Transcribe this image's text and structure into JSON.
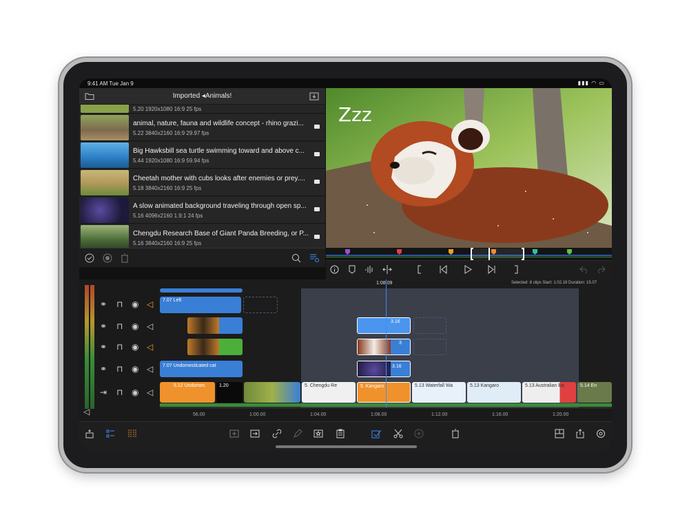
{
  "status_bar": {
    "time": "9:41 AM  Tue Jan 9",
    "indicators": "▮▮▮ ◠ ▭"
  },
  "browser": {
    "title": "Imported ◂Animals!",
    "clips": [
      {
        "title": "",
        "meta": "5.20  1920x1080  16:9  25 fps",
        "thumb": "#8aa04a"
      },
      {
        "title": "animal, nature, fauna and wildlife concept - rhino grazi...",
        "meta": "5.22  3840x2160  16:9  29.97 fps",
        "thumb": "#7d6a4f"
      },
      {
        "title": "Big Hawksbill sea turtle swimming toward and above c...",
        "meta": "5.44  1920x1080  16:9  59.94 fps",
        "thumb": "#2b7fc4"
      },
      {
        "title": "Cheetah mother with cubs looks after enemies or prey....",
        "meta": "5.18  3840x2160  16:9  25 fps",
        "thumb": "#b29a5a"
      },
      {
        "title": "A slow animated background traveling through open sp...",
        "meta": "5.16  4096x2160  1.9:1  24 fps",
        "thumb": "#1c1a3a"
      },
      {
        "title": "Chengdu Research Base of Giant Panda Breeding, or P...",
        "meta": "5.16  3840x2160  16:9  25 fps",
        "thumb": "#4a6a35"
      }
    ]
  },
  "viewer": {
    "overlay_text": "Zzz"
  },
  "timeline": {
    "playhead_time": "1:08.09",
    "selection_info": "Selected: 8 clips  Start: 1:02.19  Duration: 15.07",
    "ruler": [
      "56.00",
      "1:00.00",
      "1:04.00",
      "1:08.00",
      "1:12.00",
      "1:16.00",
      "1:20.00"
    ],
    "clips": {
      "title_left": "7.07  Left",
      "title_cat": "7.07  Undomesticated cat",
      "small_1": "3.16",
      "small_2": "3.16",
      "small_3": "3",
      "undomes": "5.12  Undomes",
      "audio": "1.20",
      "chengdu": "5.  Chengdu Re",
      "kangaroo": "5.  Kangaro",
      "waterfall": "5.13  Waterfall Wa",
      "kangaroo2": "5.13  Kangaro",
      "australian": "5.13  Australian Ba",
      "end": "5.14  En"
    }
  },
  "colors": {
    "accent": "#3d8cff",
    "clip_blue": "#3a7fd6",
    "clip_green": "#4caf39",
    "clip_orange": "#f0922c"
  }
}
